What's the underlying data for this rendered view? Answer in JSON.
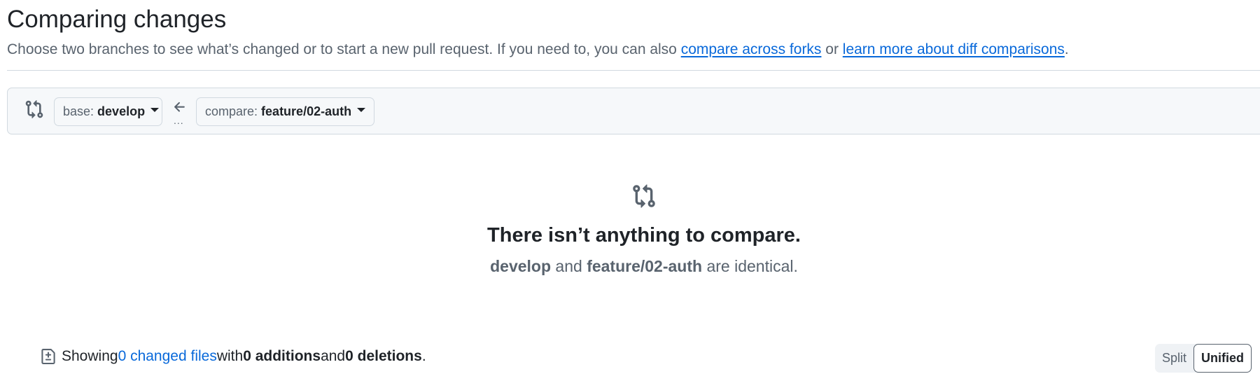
{
  "header": {
    "title": "Comparing changes",
    "subtitle_prefix": "Choose two branches to see what’s changed or to start a new pull request. If you need to, you can also ",
    "link_forks": "compare across forks",
    "subtitle_or": " or ",
    "link_learn": "learn more about diff comparisons",
    "subtitle_end": "."
  },
  "range": {
    "icon": "git-compare-icon",
    "base_prefix": "base:",
    "base_ref": "develop",
    "arrow_icon": "arrow-left-icon",
    "arrow_dots": "...",
    "compare_prefix": "compare:",
    "compare_ref": "feature/02-auth"
  },
  "blankslate": {
    "icon": "git-compare-icon",
    "heading": "There isn’t anything to compare.",
    "base": "develop",
    "and": " and ",
    "compare": "feature/02-auth",
    "suffix": " are identical."
  },
  "toc": {
    "icon": "file-diff-icon",
    "showing": "Showing ",
    "changed_files": "0 changed files",
    "with": " with ",
    "additions": "0 additions",
    "and": " and ",
    "deletions": "0 deletions",
    "end": "."
  },
  "view_toggle": {
    "split_label": "Split",
    "unified_label": "Unified",
    "selected": "Unified"
  },
  "colors": {
    "link": "#0969da",
    "muted": "#59636e",
    "text": "#1f2328",
    "border": "#d1d9e0",
    "subtle_bg": "#f6f8fa"
  }
}
